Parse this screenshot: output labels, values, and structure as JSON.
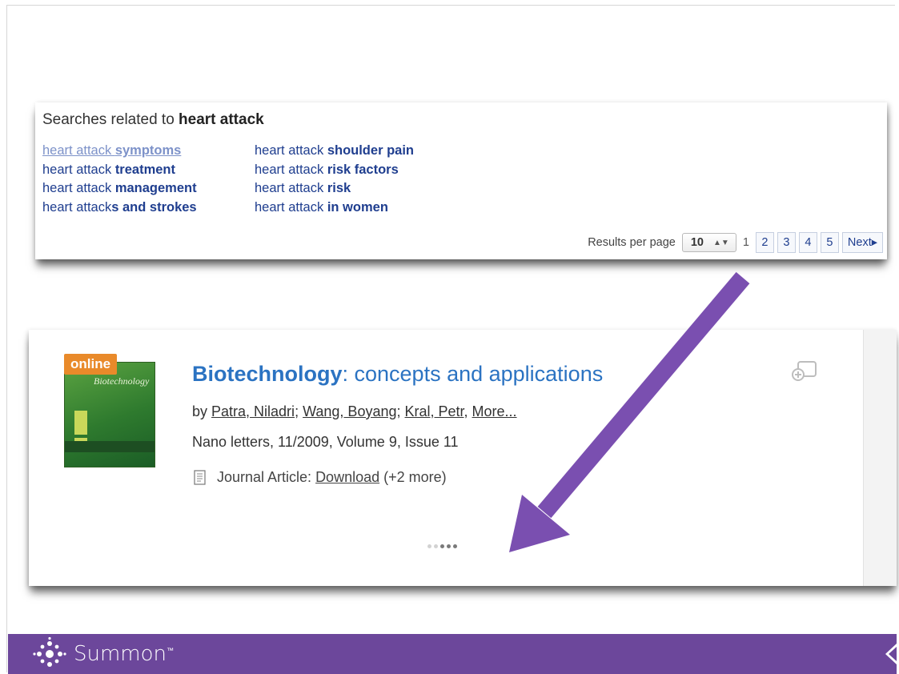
{
  "related": {
    "title_prefix": "Searches related to ",
    "title_query": "heart attack",
    "col1": [
      {
        "prefix": "heart attack ",
        "bold": "symptoms",
        "visited": true
      },
      {
        "prefix": "heart attack ",
        "bold": "treatment",
        "visited": false
      },
      {
        "prefix": "heart attack ",
        "bold": "management",
        "visited": false
      },
      {
        "prefix": "heart attack",
        "bold": "s and strokes",
        "visited": false
      }
    ],
    "col2": [
      {
        "prefix": "heart attack ",
        "bold": "shoulder pain"
      },
      {
        "prefix": "heart attack ",
        "bold": "risk factors"
      },
      {
        "prefix": "heart attack ",
        "bold": "risk"
      },
      {
        "prefix": "heart attack ",
        "bold": "in women"
      }
    ]
  },
  "pager": {
    "label": "Results per page",
    "per_page": "10",
    "current": "1",
    "pages": [
      "2",
      "3",
      "4",
      "5"
    ],
    "next": "Next▸"
  },
  "result": {
    "badge": "online",
    "cover_title": "Biotechnology",
    "title_bold": "Biotechnology",
    "title_rest": ": concepts and applications",
    "by": "by ",
    "authors": [
      "Patra, Niladri",
      "Wang, Boyang",
      "Kral, Petr"
    ],
    "more": "More...",
    "publication": "Nano letters, 11/2009, Volume 9, Issue 11",
    "type_label": "Journal Article: ",
    "download": "Download",
    "extra": " (+2 more)"
  },
  "footer": {
    "brand": "Summon",
    "tm": "™"
  },
  "colors": {
    "accent_purple": "#6c479b",
    "arrow_purple": "#7a4fb0",
    "link_blue": "#1f3e8f",
    "title_blue": "#2b73c2",
    "badge_orange": "#e98a2a"
  }
}
